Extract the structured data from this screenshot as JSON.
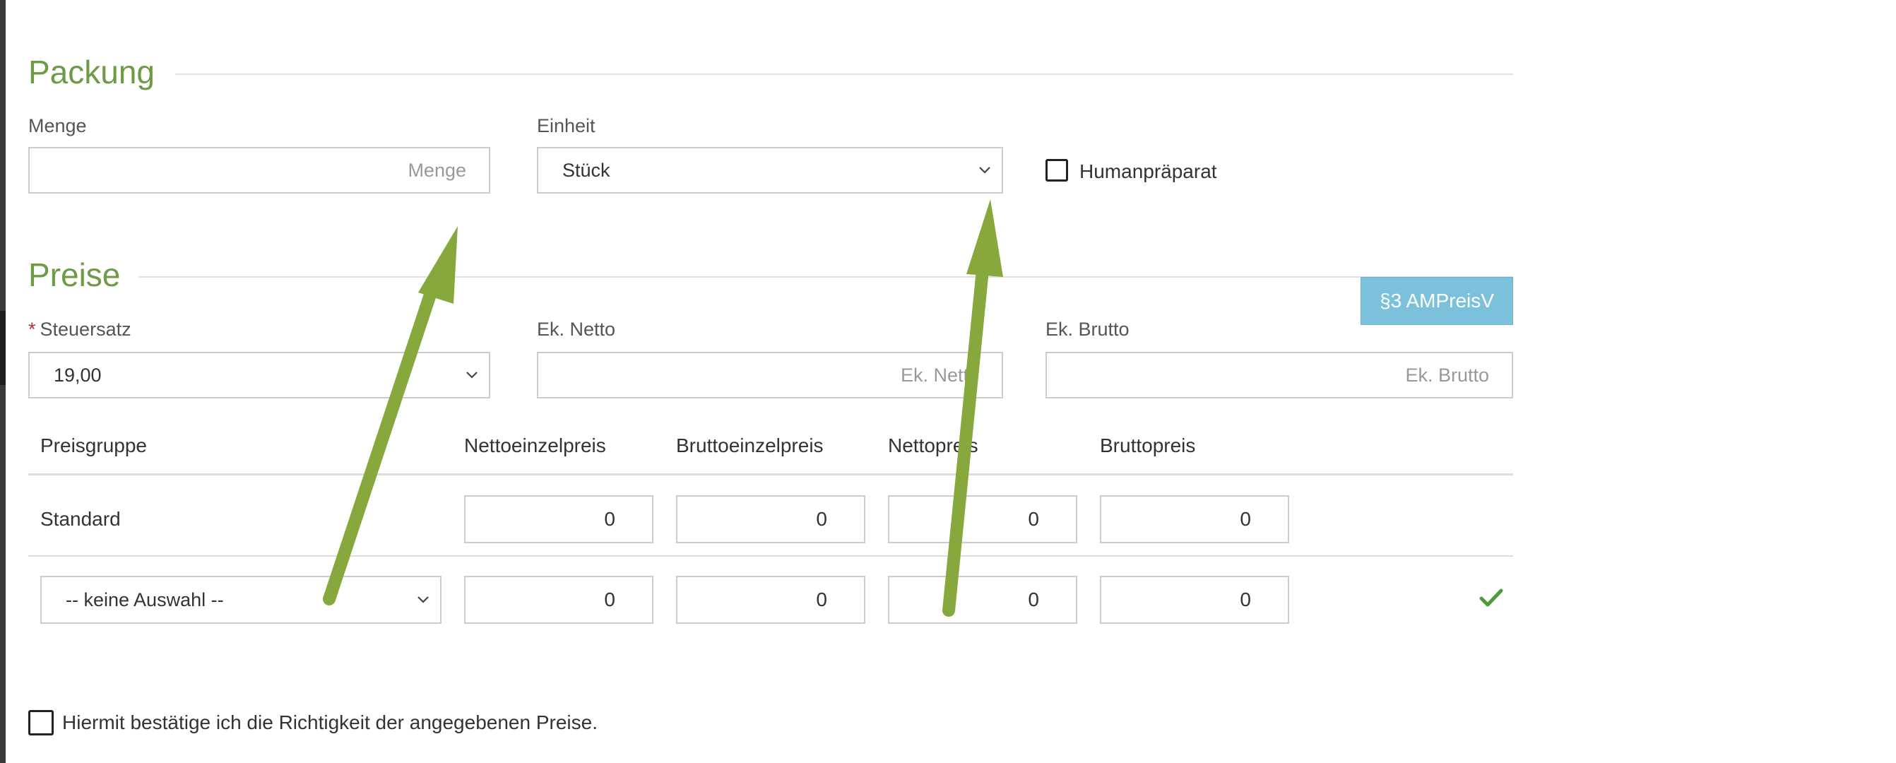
{
  "packung": {
    "title": "Packung",
    "menge": {
      "label": "Menge",
      "placeholder": "Menge",
      "value": ""
    },
    "einheit": {
      "label": "Einheit",
      "selected": "Stück"
    },
    "humanpraeparat": {
      "label": "Humanpräparat",
      "checked": false
    }
  },
  "preise": {
    "title": "Preise",
    "amp_button": "§3 AMPreisV",
    "steuersatz": {
      "required_mark": "*",
      "label": "Steuersatz",
      "selected": "19,00"
    },
    "ek_netto": {
      "label": "Ek. Netto",
      "placeholder": "Ek. Netto",
      "value": ""
    },
    "ek_brutto": {
      "label": "Ek. Brutto",
      "placeholder": "Ek. Brutto",
      "value": ""
    },
    "table": {
      "headers": [
        "Preisgruppe",
        "Nettoeinzelpreis",
        "Bruttoeinzelpreis",
        "Nettopreis",
        "Bruttopreis"
      ],
      "rows": [
        {
          "preisgruppe": "Standard",
          "values": [
            "0",
            "0",
            "0",
            "0"
          ]
        },
        {
          "preisgruppe_select": "-- keine Auswahl --",
          "values": [
            "0",
            "0",
            "0",
            "0"
          ]
        }
      ]
    }
  },
  "confirmation": {
    "label": "Hiermit bestätige ich die Richtigkeit der angegebenen Preise.",
    "checked": false
  },
  "colors": {
    "section_title": "#6e9b45",
    "button_bg": "#7cc1dc",
    "annotation_arrow": "#86a83c",
    "checkmark": "#4e9a3a",
    "required": "#b5322f"
  },
  "icons": {
    "chevron": "chevron-down-icon",
    "confirm": "checkmark-icon",
    "annotation": "arrow-icon"
  }
}
